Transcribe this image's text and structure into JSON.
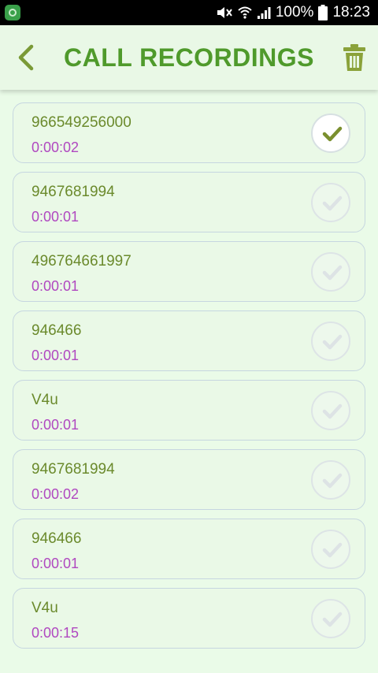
{
  "status_bar": {
    "battery": "100%",
    "time": "18:23"
  },
  "header": {
    "title": "CALL RECORDINGS",
    "back_icon": "chevron-left-icon",
    "delete_icon": "trash-icon"
  },
  "colors": {
    "accent": "#4f9a2b",
    "name_text": "#6b8a2c",
    "duration_text": "#b048c0",
    "background": "#eafbe8"
  },
  "recordings": [
    {
      "name": "966549256000",
      "duration": "0:00:02",
      "selected": true
    },
    {
      "name": "9467681994",
      "duration": "0:00:01",
      "selected": false
    },
    {
      "name": "496764661997",
      "duration": "0:00:01",
      "selected": false
    },
    {
      "name": "946466",
      "duration": "0:00:01",
      "selected": false
    },
    {
      "name": "V4u",
      "duration": "0:00:01",
      "selected": false
    },
    {
      "name": "9467681994",
      "duration": "0:00:02",
      "selected": false
    },
    {
      "name": "946466",
      "duration": "0:00:01",
      "selected": false
    },
    {
      "name": "V4u",
      "duration": "0:00:15",
      "selected": false
    }
  ]
}
